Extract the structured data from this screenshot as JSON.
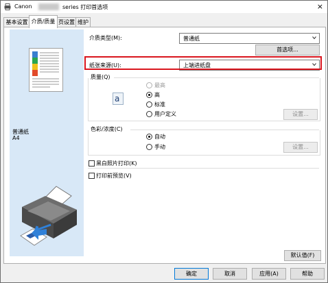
{
  "titlebar": {
    "brand": "Canon",
    "title_suffix": "series 打印首选项",
    "close": "×"
  },
  "tabs": [
    {
      "label": "基本设置"
    },
    {
      "label": "介质/质量"
    },
    {
      "label": "页设置"
    },
    {
      "label": "维护"
    }
  ],
  "left_pane": {
    "media": "普通纸",
    "size": "A4"
  },
  "media_type": {
    "label": "介质类型(M):",
    "value": "普通纸",
    "details_button": "首选项..."
  },
  "paper_source": {
    "label": "纸张来源(U):",
    "value": "上端进纸盘"
  },
  "quality": {
    "label": "质量(Q)",
    "options": [
      {
        "label": "最高",
        "selected": false,
        "disabled": true
      },
      {
        "label": "高",
        "selected": true,
        "disabled": false
      },
      {
        "label": "标准",
        "selected": false,
        "disabled": false
      },
      {
        "label": "用户定义",
        "selected": false,
        "disabled": false
      }
    ],
    "settings_button": "设置..."
  },
  "color_intensity": {
    "label": "色彩/浓度(C)",
    "options": [
      {
        "label": "自动",
        "selected": true
      },
      {
        "label": "手动",
        "selected": false
      }
    ],
    "settings_button": "设置..."
  },
  "grayscale": {
    "label": "黑白照片打印(K)",
    "checked": false
  },
  "preview": {
    "label": "打印前预览(V)",
    "checked": false
  },
  "defaults_button": "默认值(F)",
  "footer": {
    "ok": "确定",
    "cancel": "取消",
    "apply": "应用(A)",
    "help": "帮助"
  },
  "colors": {
    "accent_border": "#d9141d",
    "left_pane_bg": "#d8e8f7"
  }
}
